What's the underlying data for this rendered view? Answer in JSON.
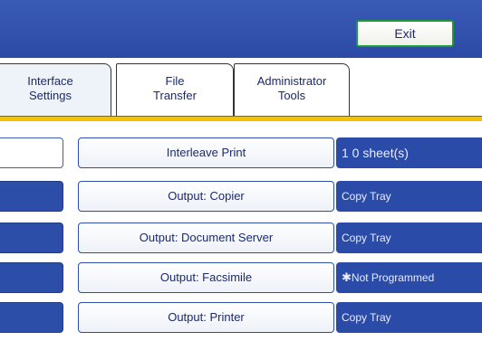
{
  "header": {
    "exit_label": "Exit"
  },
  "tabs": [
    {
      "line1": "Interface",
      "line2": "Settings"
    },
    {
      "line1": "File",
      "line2": "Transfer"
    },
    {
      "line1": "Administrator",
      "line2": "Tools"
    }
  ],
  "rows": [
    {
      "label": "Interleave Print",
      "value": "1 0 sheet(s)"
    },
    {
      "label": "Output: Copier",
      "value": "Copy Tray"
    },
    {
      "label": "Output: Document Server",
      "value": "Copy Tray"
    },
    {
      "label": "Output: Facsimile",
      "value_mark": "✱",
      "value": "Not Programmed"
    },
    {
      "label": "Output: Printer",
      "value": "Copy Tray"
    }
  ],
  "colors": {
    "header": "#2b4aa6",
    "accent_line": "#f2c200",
    "button_border": "#2c4da8",
    "value_bg": "#2b4ba8",
    "exit_border": "#1e9a38"
  }
}
